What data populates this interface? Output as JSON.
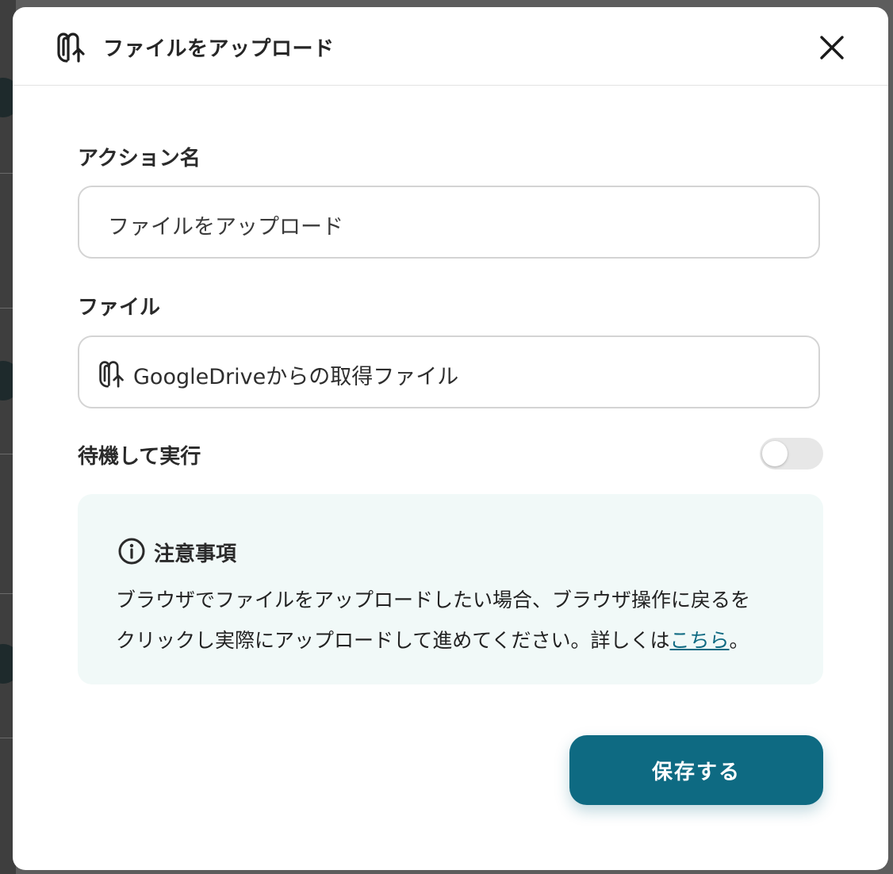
{
  "modal": {
    "title": "ファイルをアップロード",
    "close_icon": "close-icon",
    "title_icon": "paperclip-upload-icon"
  },
  "action_name": {
    "label": "アクション名",
    "value": "ファイルをアップロード"
  },
  "file": {
    "label": "ファイル",
    "value": "GoogleDriveからの取得ファイル",
    "icon": "paperclip-upload-icon"
  },
  "wait_toggle": {
    "label": "待機して実行",
    "enabled": false
  },
  "notice": {
    "icon": "info-icon",
    "title": "注意事項",
    "line1": "ブラウザでファイルをアップロードしたい場合、ブラウザ操作に戻るを",
    "line2_before": "クリックし実際にアップロードして進めてください。詳しくは",
    "link_text": "こちら",
    "line2_after": "。"
  },
  "save_button": {
    "label": "保存する",
    "color": "#0e6a82"
  }
}
